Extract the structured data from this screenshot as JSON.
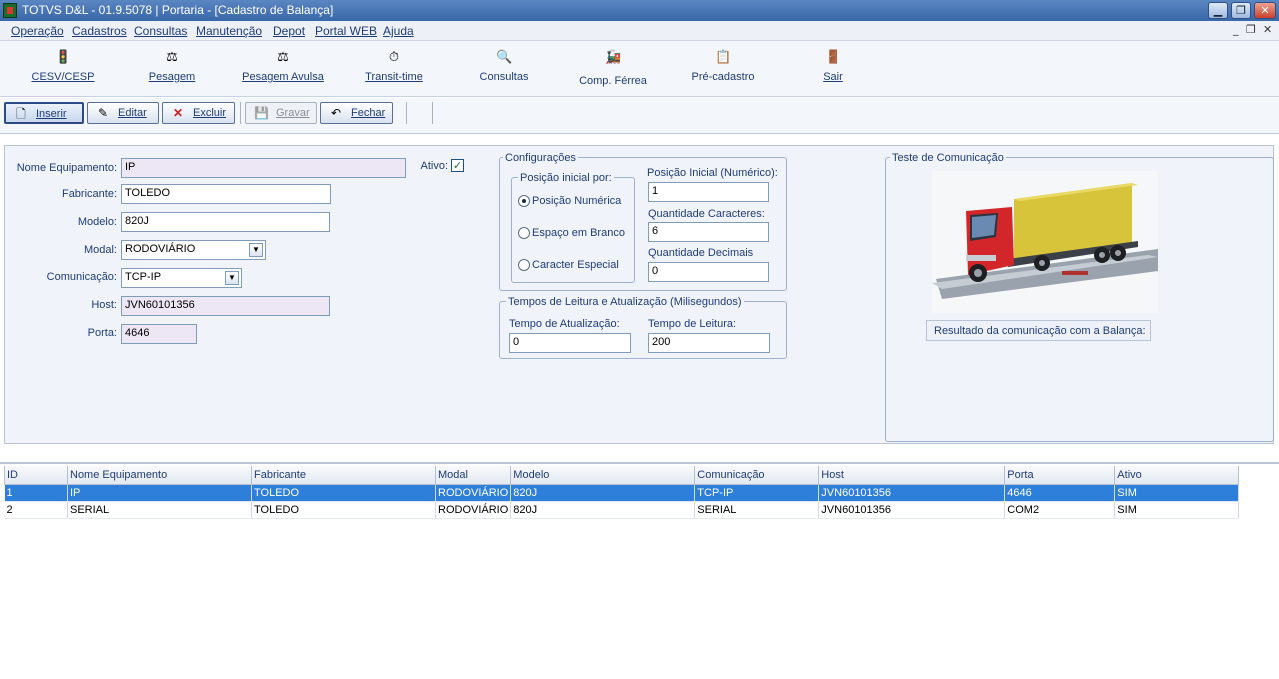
{
  "window": {
    "title": "TOTVS D&L - 01.9.5078 | Portaria - [Cadastro de Balança]",
    "controls": {
      "minimize": "▁",
      "restore": "❐",
      "close": "✕"
    }
  },
  "menubar": {
    "items": [
      "Operação",
      "Cadastros",
      "Consultas",
      "Manutenção",
      "Depot",
      "Portal WEB",
      "Ajuda"
    ],
    "mdi": {
      "minimize": "_",
      "restore": "❐",
      "close": "✕"
    }
  },
  "big_toolbar": [
    {
      "label": "CESV/CESP",
      "icon": "traffic-light-icon",
      "glyph": "🚦"
    },
    {
      "label": "Pesagem",
      "icon": "scale-icon",
      "glyph": "⚖"
    },
    {
      "label": "Pesagem Avulsa",
      "icon": "scale-single-icon",
      "glyph": "⚖"
    },
    {
      "label": "Transit-time",
      "icon": "clock-icon",
      "glyph": "⏱"
    },
    {
      "label": "Consultas",
      "icon": "search-doc-icon",
      "glyph": "🔍"
    },
    {
      "label": "Comp. Férrea",
      "icon": "train-icon",
      "glyph": "🚂"
    },
    {
      "label": "Pré-cadastro",
      "icon": "document-icon",
      "glyph": "📋"
    },
    {
      "label": "Sair",
      "icon": "exit-door-icon",
      "glyph": "🚪"
    }
  ],
  "action_bar": {
    "inserir": {
      "label": "Inserir",
      "glyph": "🗋"
    },
    "editar": {
      "label": "Editar",
      "glyph": "✎"
    },
    "excluir": {
      "label": "Excluir",
      "glyph": "✕"
    },
    "gravar": {
      "label": "Gravar",
      "glyph": "💾"
    },
    "fechar": {
      "label": "Fechar",
      "glyph": "↶"
    }
  },
  "form": {
    "nome_equipamento": {
      "label": "Nome Equipamento:",
      "value": "IP"
    },
    "ativo": {
      "label": "Ativo:",
      "checked": "✓"
    },
    "fabricante": {
      "label": "Fabricante:",
      "value": "TOLEDO"
    },
    "modelo": {
      "label": "Modelo:",
      "value": "820J"
    },
    "modal": {
      "label": "Modal:",
      "value": "RODOVIÁRIO"
    },
    "comunicacao": {
      "label": "Comunicação:",
      "value": "TCP-IP"
    },
    "host": {
      "label": "Host:",
      "value": "JVN60101356"
    },
    "porta": {
      "label": "Porta:",
      "value": "4646"
    }
  },
  "configuracoes": {
    "title": "Configurações",
    "posicao_group": {
      "title": "Posição inicial por:",
      "options": [
        "Posição Numérica",
        "Espaço em Branco",
        "Caracter Especial"
      ],
      "selected": "Posição Numérica"
    },
    "posicao_inicial": {
      "label": "Posição Inicial (Numérico):",
      "value": "1"
    },
    "quantidade_caracteres": {
      "label": "Quantidade Caracteres:",
      "value": "6"
    },
    "quantidade_decimais": {
      "label": "Quantidade Decimais",
      "value": "0"
    }
  },
  "tempos": {
    "title": "Tempos de Leitura e Atualização (Milisegundos)",
    "atualizacao": {
      "label": "Tempo de Atualização:",
      "value": "0"
    },
    "leitura": {
      "label": "Tempo de Leitura:",
      "value": "200"
    }
  },
  "teste": {
    "title": "Teste de Comunicação",
    "result_label": "Resultado da comunicação com a Balança:"
  },
  "grid": {
    "columns": [
      "ID",
      "Nome Equipamento",
      "Fabricante",
      "Modal",
      "Modelo",
      "Comunicação",
      "Host",
      "Porta",
      "Ativo"
    ],
    "rows": [
      [
        "1",
        "IP",
        "TOLEDO",
        "RODOVIÁRIO",
        "820J",
        "TCP-IP",
        "JVN60101356",
        "4646",
        "SIM"
      ],
      [
        "2",
        "SERIAL",
        "TOLEDO",
        "RODOVIÁRIO",
        "820J",
        "SERIAL",
        "JVN60101356",
        "COM2",
        "SIM"
      ]
    ],
    "selected_row": 0
  },
  "colors": {
    "accent": "#1f3c7a",
    "selection": "#2e7fd9",
    "title_bar": "#3a67a8"
  }
}
